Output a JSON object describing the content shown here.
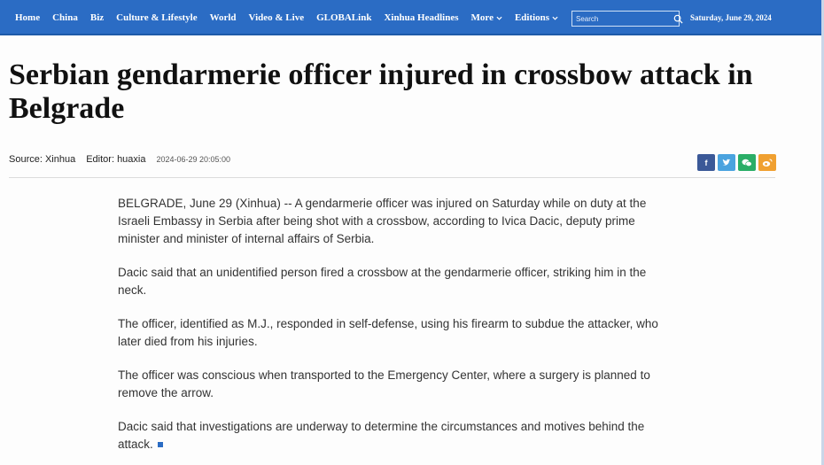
{
  "nav": {
    "items": [
      {
        "label": "Home"
      },
      {
        "label": "China"
      },
      {
        "label": "Biz"
      },
      {
        "label": "Culture & Lifestyle"
      },
      {
        "label": "World"
      },
      {
        "label": "Video & Live"
      },
      {
        "label": "GLOBALink"
      },
      {
        "label": "Xinhua Headlines"
      },
      {
        "label": "More"
      },
      {
        "label": "Editions"
      }
    ],
    "search_placeholder": "Search",
    "date": "Saturday, June 29, 2024"
  },
  "article": {
    "headline": "Serbian gendarmerie officer injured in crossbow attack in Belgrade",
    "source": "Source: Xinhua",
    "editor": "Editor: huaxia",
    "timestamp": "2024-06-29 20:05:00",
    "paragraphs": [
      "BELGRADE, June 29 (Xinhua) -- A gendarmerie officer was injured on Saturday while on duty at the Israeli Embassy in Serbia after being shot with a crossbow, according to Ivica Dacic, deputy prime minister and minister of internal affairs of Serbia.",
      "Dacic said that an unidentified person fired a crossbow at the gendarmerie officer, striking him in the neck.",
      "The officer, identified as M.J., responded in self-defense, using his firearm to subdue the attacker, who later died from his injuries.",
      "The officer was conscious when transported to the Emergency Center, where a surgery is planned to remove the arrow.",
      "Dacic said that investigations are underway to determine the circumstances and motives behind the attack."
    ]
  },
  "share": [
    {
      "icon": "facebook-icon",
      "glyph": "f",
      "color": "#3b5998"
    },
    {
      "icon": "twitter-icon",
      "glyph": "t",
      "color": "#4aa3df"
    },
    {
      "icon": "wechat-icon",
      "glyph": "w",
      "color": "#2aae67"
    },
    {
      "icon": "weibo-icon",
      "glyph": "wb",
      "color": "#f0a030"
    }
  ],
  "colors": {
    "nav_bg": "#2b6cc4",
    "end_mark": "#2b6cc4"
  }
}
